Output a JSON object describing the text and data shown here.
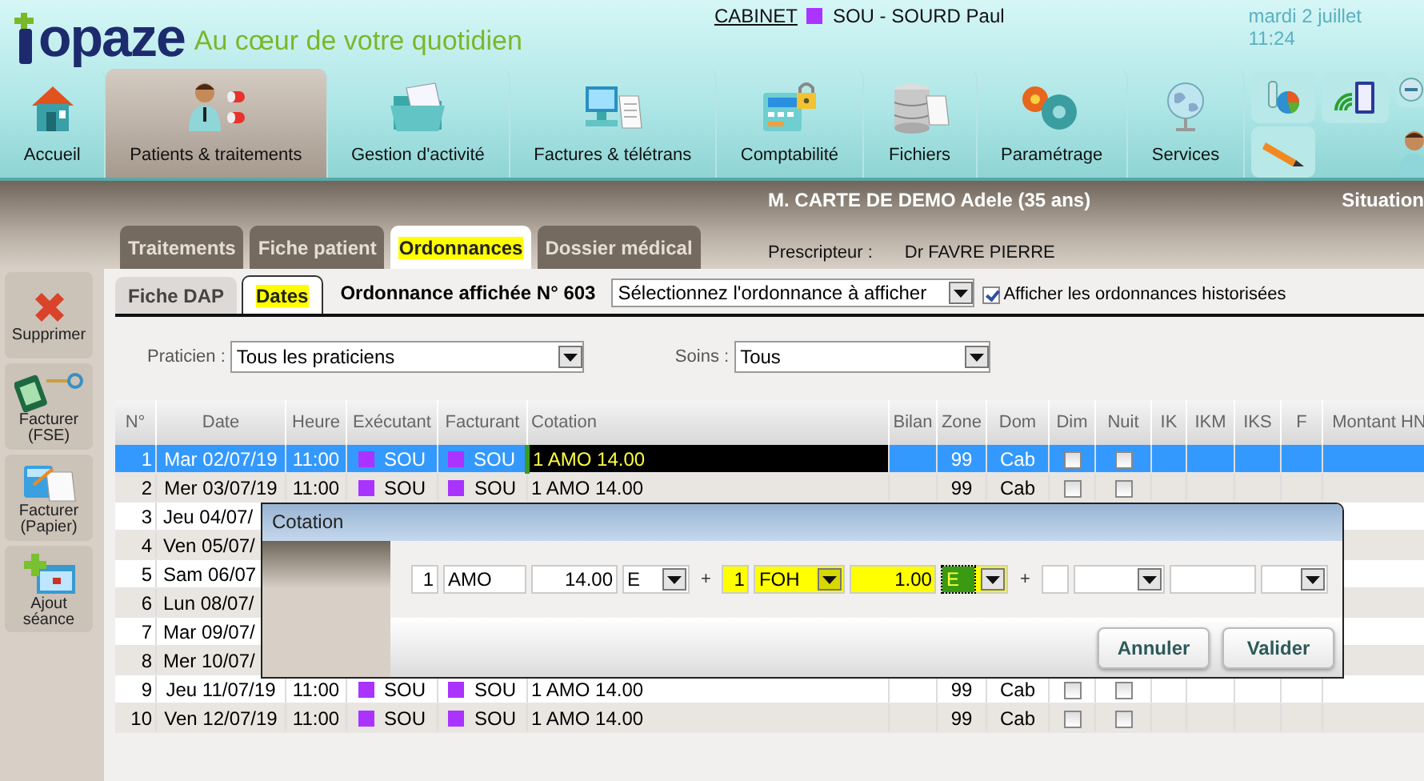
{
  "header": {
    "logo": "opaze",
    "tagline": "Au cœur de votre quotidien",
    "cabinet_link": "CABINET",
    "user": {
      "color": "#aa33ff",
      "label": "SOU - SOURD Paul"
    },
    "datetime": "mardi 2 juillet 11:24"
  },
  "nav": [
    {
      "label": "Accueil",
      "kind": "house",
      "selected": false
    },
    {
      "label": "Patients & traitements",
      "kind": "patient",
      "selected": true
    },
    {
      "label": "Gestion d'activité",
      "kind": "folder",
      "selected": false
    },
    {
      "label": "Factures & télétrans",
      "kind": "computer",
      "selected": false
    },
    {
      "label": "Comptabilité",
      "kind": "calculator",
      "selected": false
    },
    {
      "label": "Fichiers",
      "kind": "database",
      "selected": false
    },
    {
      "label": "Paramétrage",
      "kind": "gears",
      "selected": false
    },
    {
      "label": "Services",
      "kind": "globe",
      "selected": false
    }
  ],
  "nav_tools": [
    {
      "kind": "chart"
    },
    {
      "kind": "tablet"
    },
    {
      "kind": "zoom"
    },
    {
      "kind": "pencil"
    },
    {
      "kind": "user"
    }
  ],
  "patient": {
    "name": "M. CARTE DE DEMO Adele (35 ans)",
    "situation": "Situation",
    "prescriber_label": "Prescripteur :",
    "prescriber": "Dr FAVRE PIERRE"
  },
  "tabs": [
    {
      "label": "Traitements",
      "selected": false,
      "highlighted": false
    },
    {
      "label": "Fiche patient",
      "selected": false,
      "highlighted": false
    },
    {
      "label": "Ordonnances",
      "selected": true,
      "highlighted": true
    },
    {
      "label": "Dossier médical",
      "selected": false,
      "highlighted": false
    }
  ],
  "sidebar": [
    {
      "label": "Supprimer",
      "kind": "delete"
    },
    {
      "label": "Facturer (FSE)",
      "kind": "card"
    },
    {
      "label": "Facturer (Papier)",
      "kind": "paper"
    },
    {
      "label": "Ajout séance",
      "kind": "add"
    }
  ],
  "subtabs": [
    {
      "label": "Fiche DAP",
      "selected": false,
      "highlighted": false
    },
    {
      "label": "Dates",
      "selected": true,
      "highlighted": true
    }
  ],
  "prescription_title": "Ordonnance affichée N° 603",
  "prescription_select": {
    "value": "Sélectionnez l'ordonnance à afficher"
  },
  "history_checkbox": {
    "label": "Afficher les ordonnances historisées",
    "checked": true
  },
  "filters": [
    {
      "label": "Praticien :",
      "value": "Tous les praticiens"
    },
    {
      "label": "Soins :",
      "value": "Tous"
    }
  ],
  "table": {
    "columns": [
      "N°",
      "Date",
      "Heure",
      "Exécutant",
      "Facturant",
      "Cotation",
      "Bilan",
      "Zone",
      "Dom",
      "Dim",
      "Nuit",
      "IK",
      "IKM",
      "IKS",
      "F",
      "Montant HN"
    ],
    "rows": [
      {
        "n": "1",
        "date": "Mar 02/07/19",
        "heure": "11:00",
        "executant": {
          "code": "SOU",
          "color": "#aa33ff"
        },
        "facturant": {
          "code": "SOU",
          "color": "#aa33ff"
        },
        "cotation": "1 AMO 14.00",
        "zone": "99",
        "dom": "Cab",
        "dim": false,
        "nuit": false,
        "selected": true
      },
      {
        "n": "2",
        "date": "Mer 03/07/19",
        "heure": "11:00",
        "executant": {
          "code": "SOU",
          "color": "#aa33ff"
        },
        "facturant": {
          "code": "SOU",
          "color": "#aa33ff"
        },
        "cotation": "1 AMO 14.00",
        "zone": "99",
        "dom": "Cab",
        "dim": false,
        "nuit": false,
        "selected": false
      },
      {
        "n": "3",
        "date": "Jeu 04/07/",
        "selected": false
      },
      {
        "n": "4",
        "date": "Ven 05/07/",
        "selected": false
      },
      {
        "n": "5",
        "date": "Sam 06/07",
        "selected": false
      },
      {
        "n": "6",
        "date": "Lun 08/07/",
        "selected": false
      },
      {
        "n": "7",
        "date": "Mar 09/07/",
        "selected": false
      },
      {
        "n": "8",
        "date": "Mer 10/07/",
        "selected": false
      },
      {
        "n": "9",
        "date": "Jeu 11/07/19",
        "heure": "11:00",
        "executant": {
          "code": "SOU",
          "color": "#aa33ff"
        },
        "facturant": {
          "code": "SOU",
          "color": "#aa33ff"
        },
        "cotation": "1 AMO 14.00",
        "zone": "99",
        "dom": "Cab",
        "dim": false,
        "nuit": false,
        "selected": false
      },
      {
        "n": "10",
        "date": "Ven 12/07/19",
        "heure": "11:00",
        "executant": {
          "code": "SOU",
          "color": "#aa33ff"
        },
        "facturant": {
          "code": "SOU",
          "color": "#aa33ff"
        },
        "cotation": "1 AMO 14.00",
        "zone": "99",
        "dom": "Cab",
        "dim": false,
        "nuit": false,
        "selected": false
      }
    ]
  },
  "dialog": {
    "title": "Cotation",
    "fields": [
      {
        "kind": "count",
        "value": "1",
        "highlighted": false
      },
      {
        "kind": "code",
        "value": "AMO",
        "highlighted": false
      },
      {
        "kind": "amount",
        "value": "14.00",
        "highlighted": false
      },
      {
        "kind": "select",
        "value": "E",
        "highlighted": false,
        "focused": false
      },
      {
        "kind": "operator",
        "value": "+"
      },
      {
        "kind": "count",
        "value": "1",
        "highlighted": true
      },
      {
        "kind": "code_select",
        "value": "FOH",
        "highlighted": true,
        "focused": false
      },
      {
        "kind": "amount",
        "value": "1.00",
        "highlighted": true
      },
      {
        "kind": "select",
        "value": "E",
        "highlighted": true,
        "focused": true
      },
      {
        "kind": "operator",
        "value": "+"
      },
      {
        "kind": "count",
        "highlighted": false
      },
      {
        "kind": "code_select",
        "highlighted": false,
        "focused": false
      },
      {
        "kind": "amount",
        "highlighted": false
      },
      {
        "kind": "select",
        "highlighted": false,
        "focused": false
      }
    ],
    "buttons": [
      "Annuler",
      "Valider"
    ]
  }
}
